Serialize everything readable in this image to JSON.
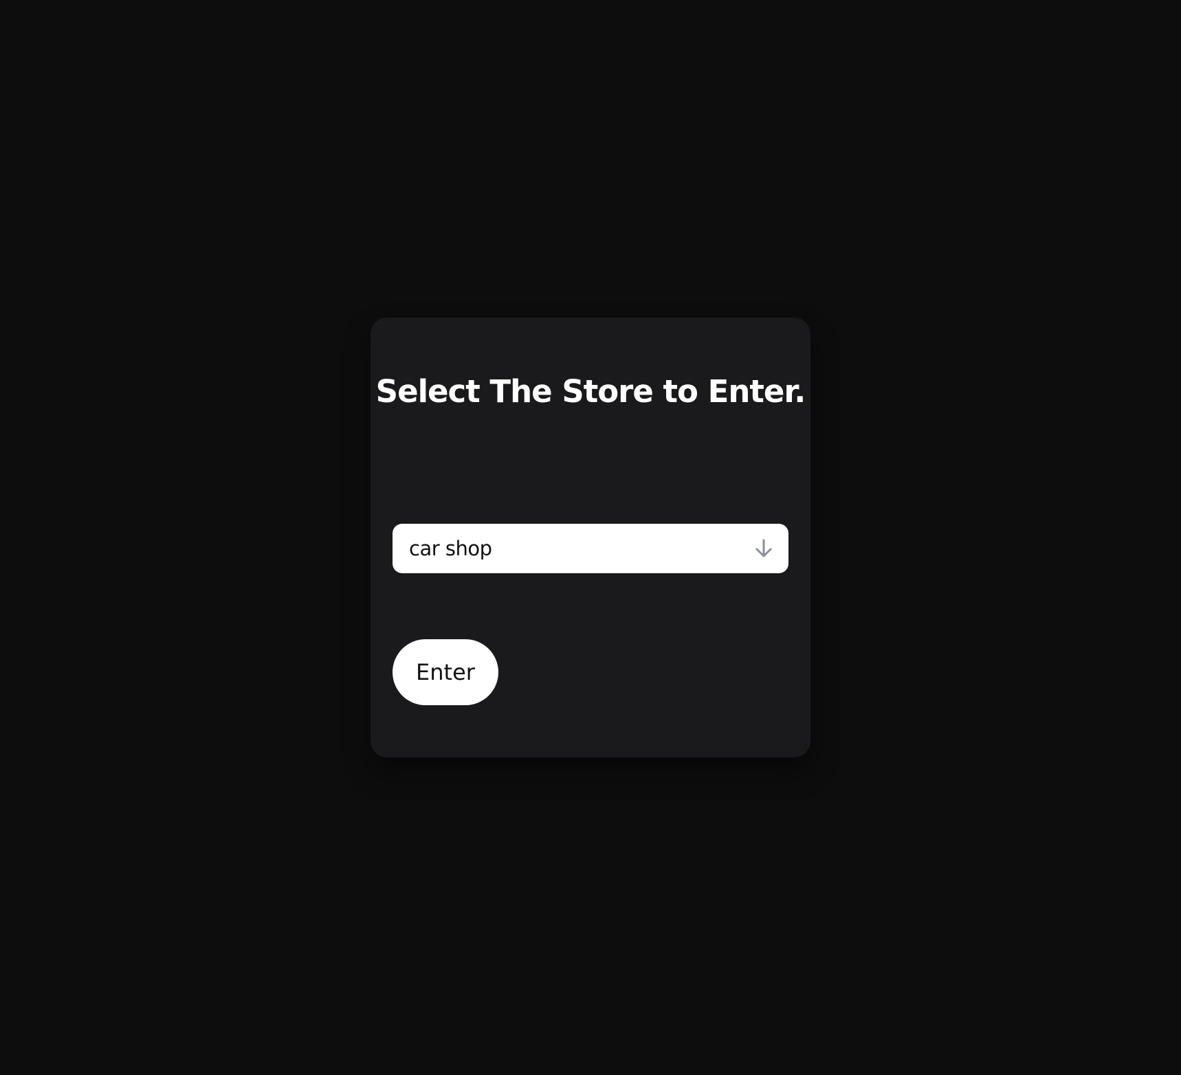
{
  "card": {
    "title": "Select The Store to Enter."
  },
  "store_select": {
    "value": "car shop",
    "icon": "arrow-down-icon"
  },
  "enter_button": {
    "label": "Enter"
  },
  "colors": {
    "background": "#0d0d0d",
    "card": "#1a1a1c",
    "control": "#ffffff",
    "icon": "#8a8f98"
  }
}
